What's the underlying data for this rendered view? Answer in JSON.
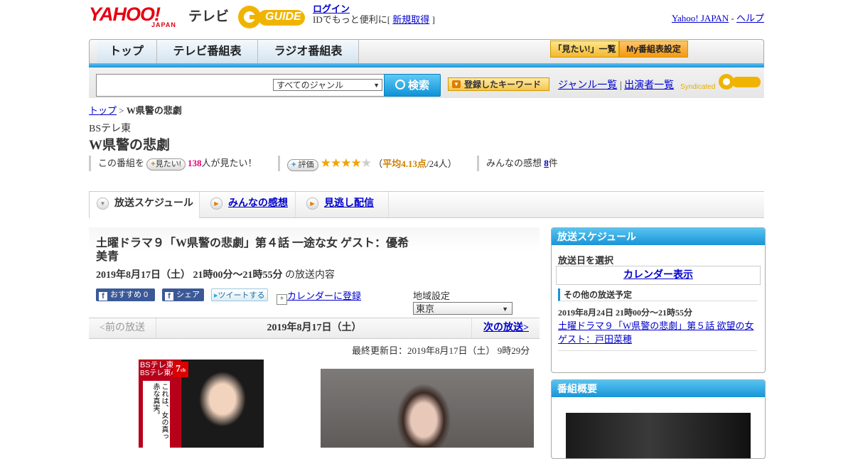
{
  "header": {
    "brand_yahoo": "YAHOO!",
    "brand_japan": "JAPAN",
    "brand_tv": "テレビ",
    "brand_gguide": "GUIDE",
    "login_link": "ログイン",
    "login_prefix": "IDでもっと便利に[",
    "signup_link": "新規取得",
    "login_suffix": "]",
    "yahoo_japan_link": "Yahoo! JAPAN",
    "separator": "-",
    "help_link": "ヘルプ"
  },
  "nav": {
    "tabs": [
      "トップ",
      "テレビ番組表",
      "ラジオ番組表"
    ],
    "want_list": "「見たい!」一覧",
    "my_schedule": "My番組表設定"
  },
  "search": {
    "genre_selected": "すべてのジャンル",
    "search_button": "検索",
    "keyword_button": "登録したキーワード",
    "genre_list": "ジャンル一覧",
    "divider": "|",
    "cast_list": "出演者一覧",
    "syndicated": "Syndicated"
  },
  "breadcrumb": {
    "home": "トップ",
    "sep": ">",
    "current": "W県警の悲劇"
  },
  "program": {
    "channel": "BSテレ東",
    "title": "W県警の悲劇",
    "want_prefix": "この番組を",
    "want_button": "見たい!",
    "want_count": "138",
    "want_suffix": "人が見たい！",
    "rating_button": "評価",
    "rating_stars": 4.13,
    "rating_text_open": "（",
    "rating_avg": "平均4.13点",
    "rating_count": "/24人",
    "rating_text_close": "）",
    "review_label": "みんなの感想",
    "review_count": "8",
    "review_suffix": "件"
  },
  "tabs": [
    "放送スケジュール",
    "みんなの感想",
    "見逃し配信"
  ],
  "episode": {
    "title": "土曜ドラマ９「W県警の悲劇」第４話 一途な女 ゲスト：優希美青",
    "datetime": "2019年8月17日（土）  21時00分～21時55分",
    "datetime_suffix": "の放送内容",
    "share_recommend": "おすすめ 0",
    "share_fb": "シェア",
    "share_tweet": "ツイートする",
    "calendar_register": "カレンダーに登録",
    "region_label": "地域設定",
    "region_value": "東京"
  },
  "pager": {
    "prev": "<前の放送",
    "current": "2019年8月17日（土）",
    "next": "次の放送>"
  },
  "last_updated": "最終更新日：2019年8月17日（土）  9時29分",
  "poster": {
    "channel_top": "BSテレ東",
    "channel_bottom": "BSテレ東4K",
    "channel_num": "7",
    "channel_suffix": "ch",
    "copy": "これは、女の真っ赤な真実。"
  },
  "sidebar": {
    "schedule_header": "放送スケジュール",
    "select_date": "放送日を選択",
    "calendar_link": "カレンダー表示",
    "other_header": "その他の放送予定",
    "other_date": "2019年8月24日  21時00分～21時55分",
    "other_link": "土曜ドラマ９「W県警の悲劇」第５話 欲望の女 ゲスト：戸田菜穂",
    "summary_header": "番組概要"
  },
  "colors": {
    "brand_red": "#e60012",
    "accent_blue": "#1a94d6",
    "link": "#0000cc",
    "want_count": "#e0007a",
    "rating": "#d08000"
  }
}
